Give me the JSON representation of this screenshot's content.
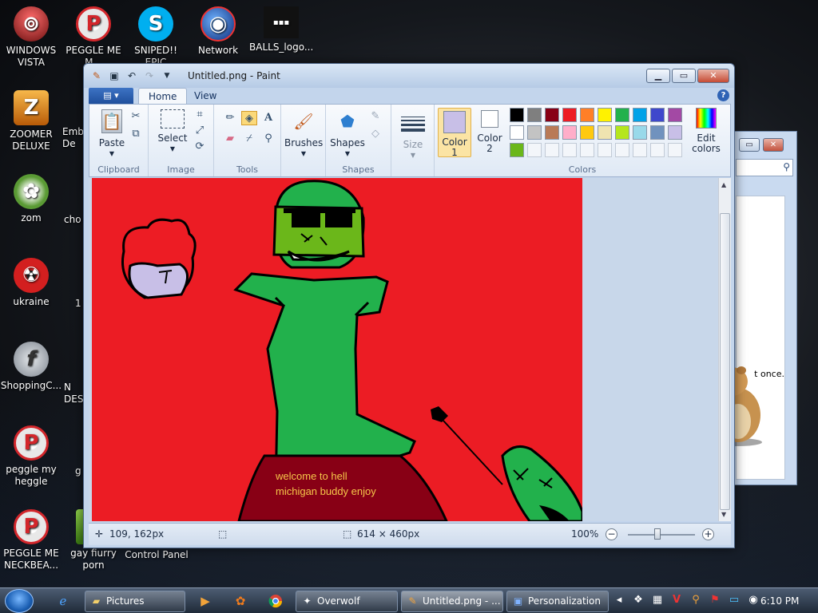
{
  "desktop": {
    "icons": [
      {
        "label": "WINDOWS VISTA",
        "icon": "vista-icon",
        "color": "#8b1f1f"
      },
      {
        "label": "PEGGLE ME M...",
        "icon": "peggle-icon",
        "color": "#d3262b"
      },
      {
        "label": "SNIPED!! EPIC",
        "icon": "skype-icon",
        "color": "#00aff0"
      },
      {
        "label": "Network",
        "icon": "network-icon",
        "color": "#1b3e9e"
      },
      {
        "label": "BALLS_logo...",
        "icon": "image-file-icon",
        "color": "#222222"
      },
      {
        "label": "ZOOMER DELUXE",
        "icon": "zuma-icon",
        "color": "#e07a10"
      },
      {
        "label": "zom",
        "icon": "flower-icon",
        "color": "#4c8a2c"
      },
      {
        "label": "ukraine",
        "icon": "radiation-icon",
        "color": "#d31f1f"
      },
      {
        "label": "ShoppingC...",
        "icon": "flash-icon",
        "color": "#9aa1aa"
      },
      {
        "label": "peggle my heggle",
        "icon": "peggle-icon",
        "color": "#d3262b"
      },
      {
        "label": "PEGGLE ME NECKBEA...",
        "icon": "peggle-icon",
        "color": "#d3262b"
      },
      {
        "label": "gay fiurry porn",
        "icon": "file-icon",
        "color": "#5a9a2a"
      },
      {
        "label": "Control Panel",
        "icon": "control-panel-icon",
        "color": "#3a6bc0"
      }
    ],
    "partial_labels": [
      "Emb De",
      "cho",
      "1",
      "N DES",
      "g"
    ]
  },
  "back_window": {
    "partial_text": "t once."
  },
  "paint": {
    "title": "Untitled.png - Paint",
    "tabs": [
      {
        "label": "Home"
      },
      {
        "label": "View"
      }
    ],
    "ribbon": {
      "clipboard": {
        "label": "Clipboard",
        "paste": "Paste"
      },
      "image": {
        "label": "Image",
        "select": "Select"
      },
      "tools": {
        "label": "Tools"
      },
      "brushes": {
        "label": "Brushes"
      },
      "shapes": {
        "label": "Shapes",
        "shapes_btn": "Shapes"
      },
      "size": {
        "label": "Size"
      },
      "colors": {
        "label": "Colors",
        "color1": "Color 1",
        "color2": "Color 2",
        "edit": "Edit colors",
        "color1_value": "#c8bfe7",
        "color2_value": "#ffffff",
        "palette_row1": [
          "#000000",
          "#7f7f7f",
          "#880015",
          "#ed1c24",
          "#ff7f27",
          "#fff200",
          "#22b14c",
          "#00a2e8",
          "#3f48cc",
          "#a349a4"
        ],
        "palette_row2": [
          "#ffffff",
          "#c3c3c3",
          "#b97a57",
          "#ffaec9",
          "#ffc90e",
          "#efe4b0",
          "#b5e61d",
          "#99d9ea",
          "#7092be",
          "#c8bfe7"
        ],
        "palette_row3": [
          "#6bb71a"
        ]
      }
    },
    "canvas": {
      "caption_line1": "welcome to hell",
      "caption_line2": "michigan buddy enjoy",
      "bg": "#ec1c24"
    },
    "status": {
      "cursor_pos": "109, 162px",
      "image_size": "614 × 460px",
      "zoom": "100%"
    }
  },
  "taskbar": {
    "buttons": [
      {
        "label": "Pictures"
      },
      {
        "label": "Overwolf"
      },
      {
        "label": "Untitled.png - ..."
      },
      {
        "label": "Personalization"
      }
    ],
    "clock": "6:10 PM"
  }
}
